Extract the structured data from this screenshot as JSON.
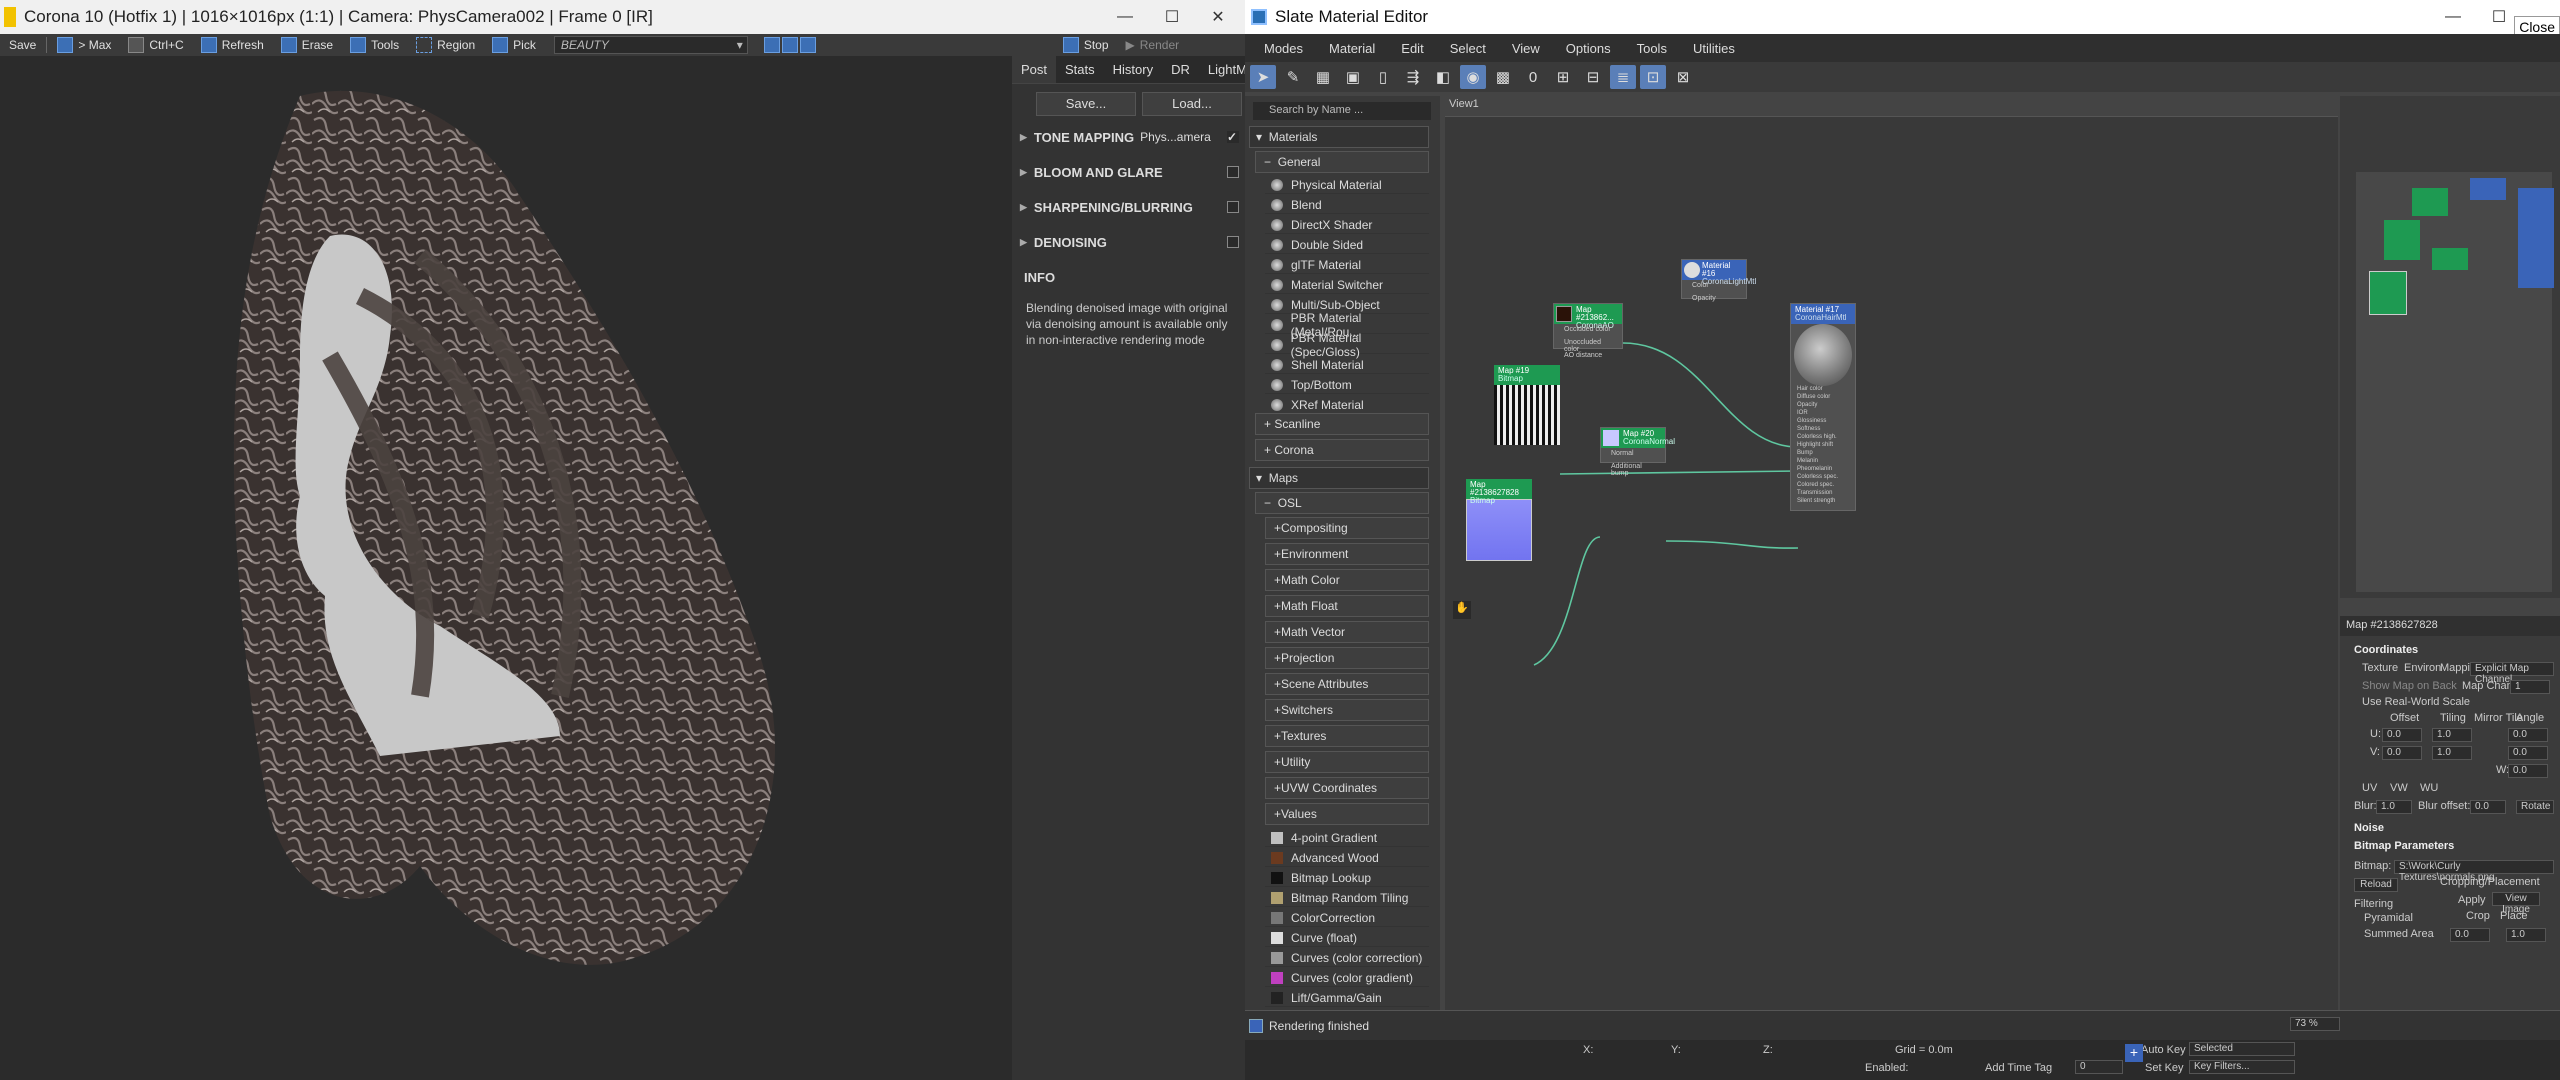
{
  "corona": {
    "title": "Corona 10 (Hotfix 1) | 1016×1016px (1:1) | Camera: PhysCamera002 | Frame 0 [IR]",
    "toolbar": {
      "save": "Save",
      "max": "> Max",
      "ctrlc": "Ctrl+C",
      "refresh": "Refresh",
      "erase": "Erase",
      "tools": "Tools",
      "region": "Region",
      "pick": "Pick",
      "pass": "BEAUTY",
      "stop": "Stop",
      "render": "Render"
    },
    "tabs": [
      "Post",
      "Stats",
      "History",
      "DR",
      "LightMix"
    ],
    "save_btn": "Save...",
    "load_btn": "Load...",
    "sections": [
      {
        "label": "TONE MAPPING",
        "value": "Phys...amera",
        "checked": true
      },
      {
        "label": "BLOOM AND GLARE",
        "checked": false
      },
      {
        "label": "SHARPENING/BLURRING",
        "checked": false
      },
      {
        "label": "DENOISING",
        "checked": false
      }
    ],
    "info_title": "INFO",
    "info_text": "Blending denoised image with original via denoising amount is available only in non-interactive rendering mode"
  },
  "slate": {
    "title": "Slate Material Editor",
    "close_tip": "Close",
    "menus": [
      "Modes",
      "Material",
      "Edit",
      "Select",
      "View",
      "Options",
      "Tools",
      "Utilities"
    ],
    "search_placeholder": "Search by Name ...",
    "materials_head": "Materials",
    "general_head": "General",
    "general_items": [
      "Physical Material",
      "Blend",
      "DirectX Shader",
      "Double Sided",
      "glTF Material",
      "Material Switcher",
      "Multi/Sub-Object",
      "PBR Material (Metal/Rou...",
      "PBR Material (Spec/Gloss)",
      "Shell Material",
      "Top/Bottom",
      "XRef Material"
    ],
    "scanline": "Scanline",
    "corona": "Corona",
    "maps_head": "Maps",
    "osl_head": "OSL",
    "osl_items": [
      "Compositing",
      "Environment",
      "Math Color",
      "Math Float",
      "Math Vector",
      "Projection",
      "Scene Attributes",
      "Switchers",
      "Textures",
      "Utility",
      "UVW Coordinates",
      "Values"
    ],
    "map_items": [
      {
        "label": "4-point Gradient",
        "color": "#c0c0c0"
      },
      {
        "label": "Advanced Wood",
        "color": "#6b3a1f"
      },
      {
        "label": "Bitmap Lookup",
        "color": "#111111"
      },
      {
        "label": "Bitmap Random Tiling",
        "color": "#b0a070"
      },
      {
        "label": "ColorCorrection",
        "color": "#777777"
      },
      {
        "label": "Curve (float)",
        "color": "#dddddd"
      },
      {
        "label": "Curves (color correction)",
        "color": "#999999"
      },
      {
        "label": "Curves (color gradient)",
        "color": "#c040c0"
      },
      {
        "label": "Lift/Gamma/Gain",
        "color": "#222222"
      }
    ],
    "view_tab": "View1",
    "nodes": {
      "n1": {
        "title": "Map #213862...",
        "sub": "CoronaAO",
        "rows": [
          "Occluded color",
          "Unoccluded color",
          "AO distance"
        ]
      },
      "n2": {
        "title": "Material #16",
        "sub": "CoronaLightMtl",
        "rows": [
          "Color",
          "Opacity"
        ]
      },
      "n3": {
        "title": "Material #17",
        "sub": "CoronaHairMtl",
        "rows": [
          "Hair color",
          "Diffuse color",
          "Opacity",
          "IOR",
          "Glossiness",
          "Softness",
          "Colorless high.",
          "Highlight shift",
          "Bump",
          "Melanin",
          "Pheomelanin",
          "Colorless spec.",
          "Colored spec.",
          "Transmission",
          "Silent strength"
        ]
      },
      "n4": {
        "title": "Map #19",
        "sub": "Bitmap"
      },
      "n5": {
        "title": "Map #20",
        "sub": "CoronaNormal",
        "rows": [
          "Normal",
          "Additional bump"
        ]
      },
      "n6": {
        "title": "Map #2138627828",
        "sub": "Bitmap"
      }
    },
    "params": {
      "header": "Map #2138627828",
      "coordinates": "Coordinates",
      "texture": "Texture",
      "environ": "Environ",
      "mapping_label": "Mapping:",
      "mapping": "Explicit Map Channel",
      "show_map": "Show Map on Back",
      "map_channel_label": "Map Channel:",
      "map_channel": "1",
      "real_world": "Use Real-World Scale",
      "offset": "Offset",
      "tiling": "Tiling",
      "mirror": "Mirror Tile",
      "angle": "Angle",
      "u_label": "U:",
      "v_label": "V:",
      "w_label": "W:",
      "u_off": "0.0",
      "u_til": "1.0",
      "u_ang": "0.0",
      "v_off": "0.0",
      "v_til": "1.0",
      "v_ang": "0.0",
      "w_ang": "0.0",
      "uv": "UV",
      "vw": "VW",
      "wu": "WU",
      "blur_label": "Blur:",
      "blur": "1.0",
      "blur_offset_label": "Blur offset:",
      "blur_offset": "0.0",
      "rotate": "Rotate",
      "noise": "Noise",
      "bitmap_params": "Bitmap Parameters",
      "bitmap_label": "Bitmap:",
      "bitmap_path": "S:\\Work\\Curly Textures\\normals.png",
      "reload": "Reload",
      "cropping": "Cropping/Placement",
      "apply": "Apply",
      "view_image": "View Image",
      "crop": "Crop",
      "place": "Place",
      "filtering": "Filtering",
      "pyramidal": "Pyramidal",
      "summed": "Summed Area",
      "u_crop": "0.0",
      "w_crop": "1.0"
    },
    "status": "Rendering finished",
    "zoom": "73 %",
    "anim": {
      "grid": "Grid = 0.0m",
      "enabled": "Enabled:",
      "time_tag": "Add Time Tag",
      "auto_key": "Auto Key",
      "selected": "Selected",
      "set_key": "Set Key",
      "key_filters": "Key Filters...",
      "frame": "0",
      "x": "X:",
      "y": "Y:",
      "z": "Z:"
    }
  }
}
